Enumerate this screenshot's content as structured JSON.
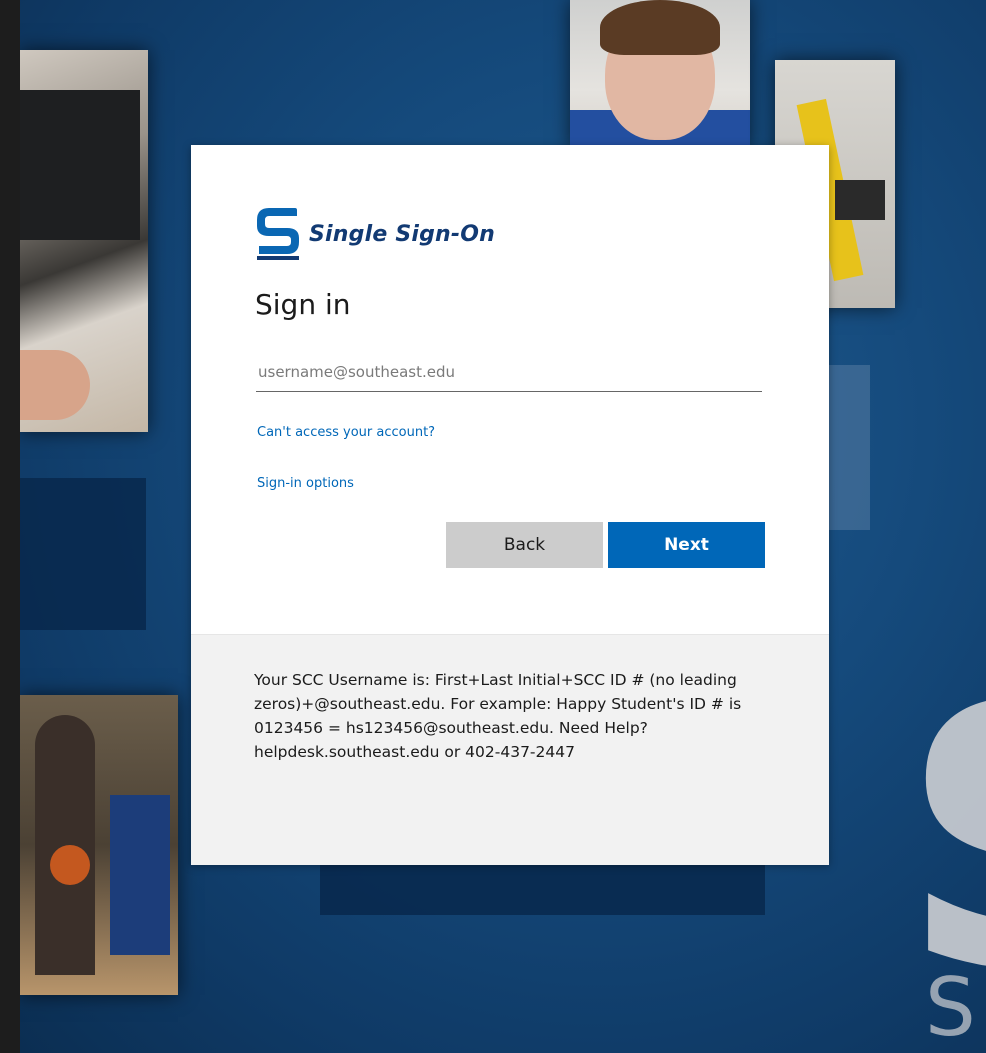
{
  "brand": {
    "logo_text": "Single Sign-On",
    "primary_color": "#0067b8",
    "logo_color": "#123a73"
  },
  "signin": {
    "title": "Sign in",
    "email_placeholder": "username@southeast.edu",
    "email_value": "",
    "cant_access_link": "Can't access your account?",
    "signin_options_link": "Sign-in options",
    "back_button": "Back",
    "next_button": "Next"
  },
  "footer": {
    "help_text": "Your SCC Username is: First+Last Initial+SCC ID # (no leading zeros)+@southeast.edu. For example: Happy Student's ID # is 0123456 = hs123456@southeast.edu. Need Help? helpdesk.southeast.edu or 402-437-2447"
  },
  "background": {
    "watermark_large": "S",
    "watermark_small": "S"
  },
  "icons": {
    "logo": "scc-s-logo-icon"
  }
}
